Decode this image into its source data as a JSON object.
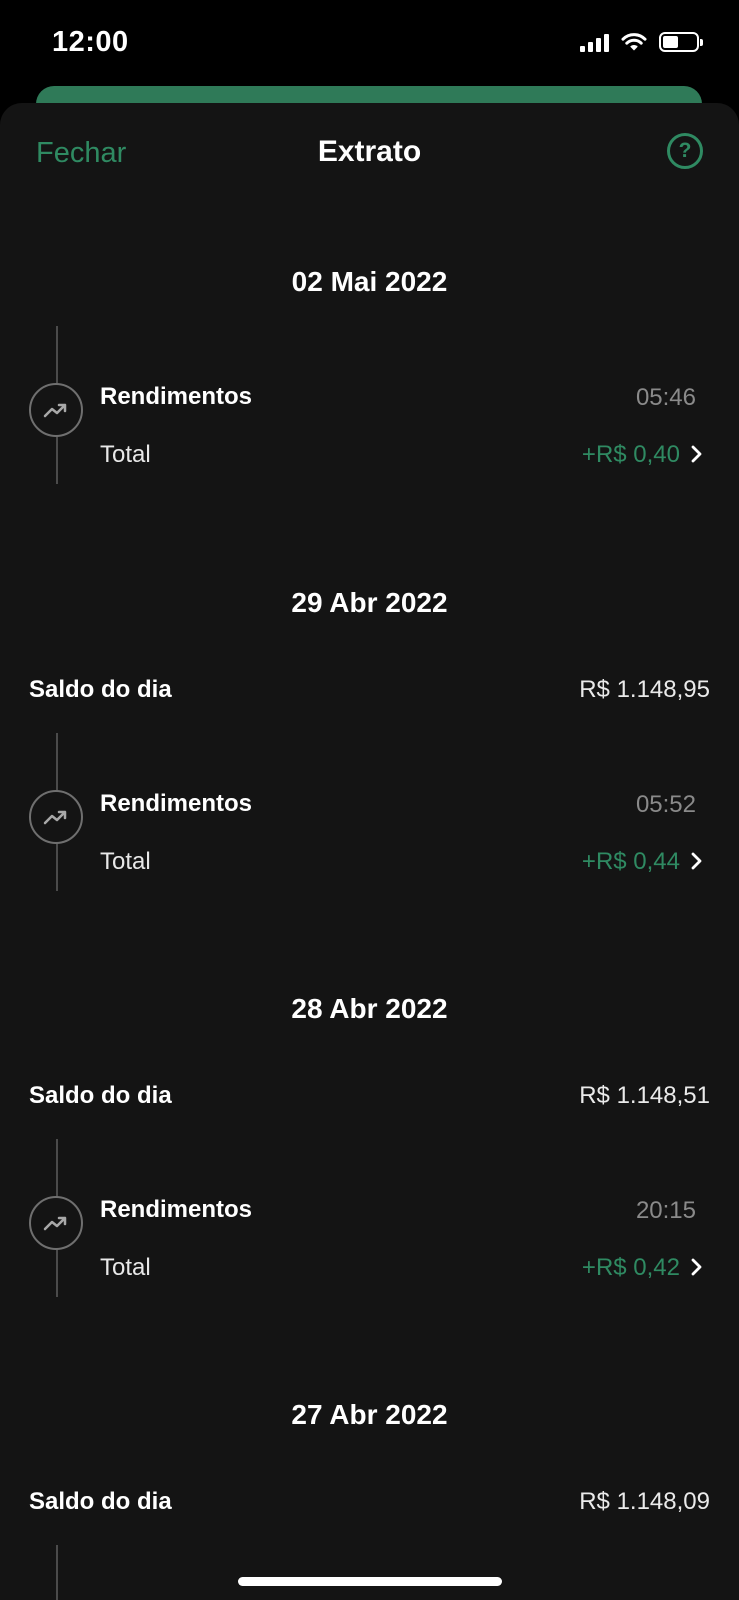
{
  "status_bar": {
    "time": "12:00"
  },
  "header": {
    "close_label": "Fechar",
    "title": "Extrato",
    "help_label": "?"
  },
  "colors": {
    "accent": "#2f8a62",
    "background": "#141414"
  },
  "days": [
    {
      "date": "02 Mai 2022",
      "transaction": {
        "title": "Rendimentos",
        "time": "05:46",
        "sub": "Total",
        "amount": "+R$ 0,40"
      }
    },
    {
      "date": "29 Abr 2022",
      "saldo_label": "Saldo do dia",
      "saldo_value": "R$ 1.148,95",
      "transaction": {
        "title": "Rendimentos",
        "time": "05:52",
        "sub": "Total",
        "amount": "+R$ 0,44"
      }
    },
    {
      "date": "28 Abr 2022",
      "saldo_label": "Saldo do dia",
      "saldo_value": "R$ 1.148,51",
      "transaction": {
        "title": "Rendimentos",
        "time": "20:15",
        "sub": "Total",
        "amount": "+R$ 0,42"
      }
    },
    {
      "date": "27 Abr 2022",
      "saldo_label": "Saldo do dia",
      "saldo_value": "R$ 1.148,09"
    }
  ],
  "icons": {
    "transaction": "trending-up-icon",
    "chevron": "chevron-right-icon",
    "help": "help-circle-icon"
  }
}
